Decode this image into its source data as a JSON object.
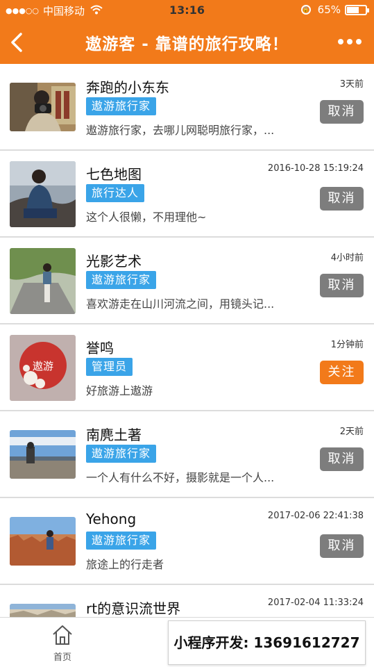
{
  "status_bar": {
    "signal": "●●●○○",
    "carrier": "中国移动",
    "time": "13:16",
    "battery_percent": "65%",
    "battery_level": 0.65
  },
  "nav": {
    "title": "遨游客 - 靠谱的旅行攻略！"
  },
  "items": [
    {
      "name": "奔跑的小东东",
      "tag": "遨游旅行家",
      "desc": "遨游旅行家，去哪儿网聪明旅行家，...",
      "time": "3天前",
      "button": "取消"
    },
    {
      "name": "七色地图",
      "tag": "旅行达人",
      "desc": "这个人很懒，不用理他~",
      "time": "2016-10-28 15:19:24",
      "button": "取消"
    },
    {
      "name": "光影艺术",
      "tag": "遨游旅行家",
      "desc": "喜欢游走在山川河流之间，用镜头记...",
      "time": "4小时前",
      "button": "取消"
    },
    {
      "name": "誉鸣",
      "tag": "管理员",
      "desc": "好旅游上遨游",
      "time": "1分钟前",
      "button": "关注"
    },
    {
      "name": "南麂土著",
      "tag": "遨游旅行家",
      "desc": "一个人有什么不好，摄影就是一个人...",
      "time": "2天前",
      "button": "取消"
    },
    {
      "name": "Yehong",
      "tag": "遨游旅行家",
      "desc": "旅途上的行走者",
      "time": "2017-02-06 22:41:38",
      "button": "取消"
    },
    {
      "name": "rt的意识流世界",
      "tag": "",
      "desc": "",
      "time": "2017-02-04 11:33:24",
      "button": ""
    }
  ],
  "avatar_logo_text": "遨游",
  "tabbar": {
    "home_label": "首页",
    "promo_text": "小程序开发: 13691612727"
  },
  "colors": {
    "brand_orange": "#f27a1a",
    "tag_blue": "#3aa4e8",
    "cancel_gray": "#7d7d7d"
  }
}
